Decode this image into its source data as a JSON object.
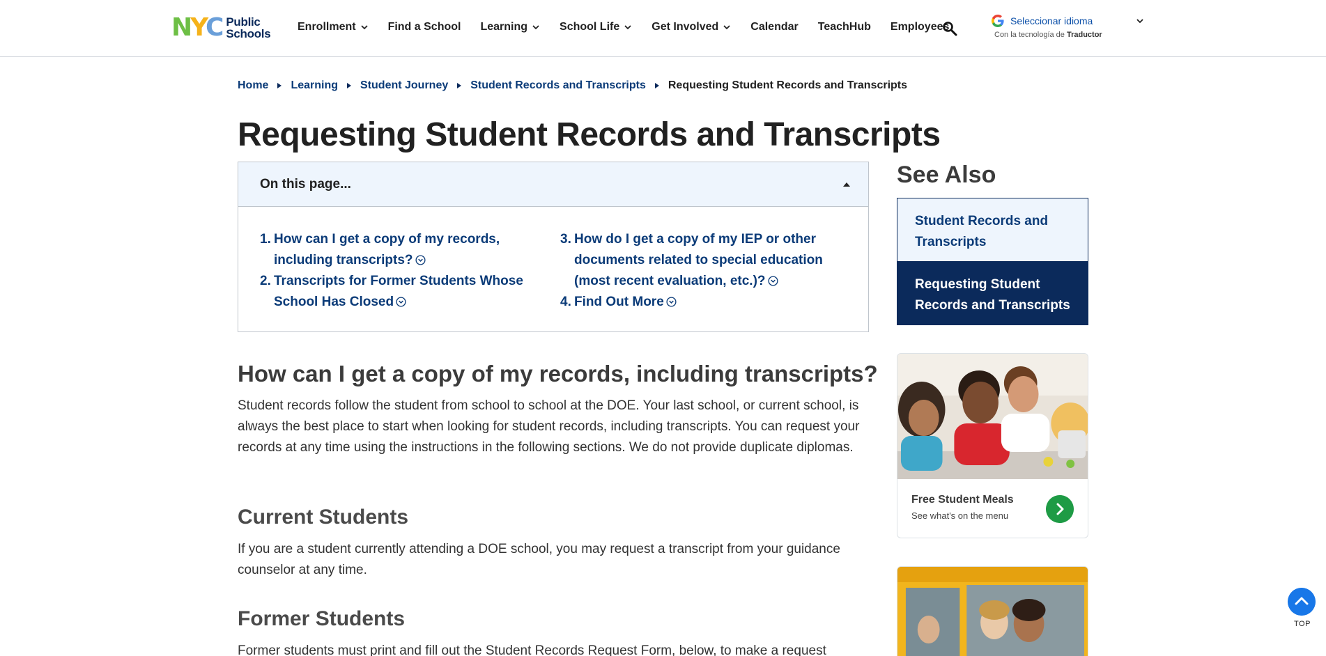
{
  "header": {
    "logo_mark": "NYC",
    "logo_text_1": "Public",
    "logo_text_2": "Schools",
    "nav": [
      {
        "label": "Enrollment",
        "dropdown": true
      },
      {
        "label": "Find a School",
        "dropdown": false
      },
      {
        "label": "Learning",
        "dropdown": true
      },
      {
        "label": "School Life",
        "dropdown": true
      },
      {
        "label": "Get Involved",
        "dropdown": true
      },
      {
        "label": "Calendar",
        "dropdown": false
      },
      {
        "label": "TeachHub",
        "dropdown": false
      },
      {
        "label": "Employees",
        "dropdown": false
      }
    ],
    "search_icon": "search-icon",
    "translate": {
      "label": "Seleccionar idioma",
      "powered_prefix": "Con la tecnología de",
      "powered_brand": "Traductor"
    }
  },
  "breadcrumb": [
    "Home",
    "Learning",
    "Student Journey",
    "Student Records and Transcripts",
    "Requesting Student Records and Transcripts"
  ],
  "page": {
    "title": "Requesting Student Records and Transcripts"
  },
  "toc": {
    "heading": "On this page...",
    "items": [
      {
        "num": "1.",
        "text": "How can I get a copy of my records, including transcripts?"
      },
      {
        "num": "2.",
        "text": "Transcripts for Former Students Whose School Has Closed"
      },
      {
        "num": "3.",
        "text": "How do I get a copy of my IEP or other documents related to special education (most recent evaluation, etc.)?"
      },
      {
        "num": "4.",
        "text": "Find Out More"
      }
    ]
  },
  "content": {
    "h2": "How can I get a copy of my records, including transcripts?",
    "p1": "Student records follow the student from school to school at the DOE. Your last school, or current school, is always the best place to start when looking for student records, including transcripts. You can request your records at any time using the instructions in the following sections. We do not provide duplicate diplomas.",
    "h3_current": "Current Students",
    "p_current": "If you are a student currently attending a DOE school, you may request a transcript from your guidance counselor at any time.",
    "h3_former": "Former Students",
    "p_former": "Former students must print and fill out the Student Records Request Form, below, to make a request"
  },
  "sidebar": {
    "see_also": "See Also",
    "links": [
      "Student Records and Transcripts",
      "Requesting Student Records and Transcripts"
    ],
    "card1": {
      "title": "Free Student Meals",
      "subtitle": "See what's on the menu"
    }
  },
  "top_button": {
    "label": "TOP"
  },
  "colors": {
    "brand_navy": "#0b2a5b",
    "link_blue": "#0b3b78",
    "light_blue_bg": "#eef5fd",
    "green": "#1e9b45",
    "top_blue": "#1877e8"
  }
}
